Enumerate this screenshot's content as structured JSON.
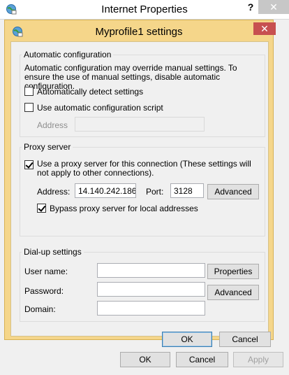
{
  "parent_window": {
    "title": "Internet Properties",
    "help_label": "?",
    "close_label": "✕",
    "icon": "internet-options-globe-icon",
    "buttons": {
      "ok": "OK",
      "cancel": "Cancel",
      "apply": "Apply"
    }
  },
  "dialog": {
    "title": "Myprofile1 settings",
    "close_label": "✕",
    "icon": "internet-options-globe-icon",
    "auto_config": {
      "legend": "Automatic configuration",
      "description": "Automatic configuration may override manual settings.  To ensure the use of manual settings, disable automatic configuration.",
      "detect_label": "Automatically detect settings",
      "detect_checked": false,
      "script_label": "Use automatic configuration script",
      "script_checked": false,
      "address_label": "Address",
      "address_value": ""
    },
    "proxy": {
      "legend": "Proxy server",
      "use_proxy_label": "Use a proxy server for this connection (These settings will not apply to other connections).",
      "use_proxy_checked": true,
      "address_label": "Address:",
      "address_value": "14.140.242.186",
      "port_label": "Port:",
      "port_value": "3128",
      "advanced_label": "Advanced",
      "bypass_label": "Bypass proxy server for local addresses",
      "bypass_checked": true
    },
    "dialup": {
      "legend": "Dial-up settings",
      "username_label": "User name:",
      "username_value": "",
      "password_label": "Password:",
      "password_value": "",
      "domain_label": "Domain:",
      "domain_value": "",
      "properties_label": "Properties",
      "advanced_label": "Advanced"
    },
    "buttons": {
      "ok": "OK",
      "cancel": "Cancel"
    }
  },
  "colors": {
    "dialog_frame": "#f5d68a",
    "close_button": "#c75050",
    "default_button_border": "#3c7fb1"
  }
}
